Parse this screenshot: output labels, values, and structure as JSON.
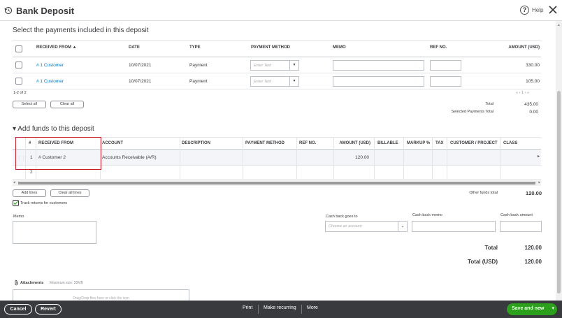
{
  "header": {
    "title": "Bank Deposit",
    "help": "Help",
    "help_icon": "?"
  },
  "payments": {
    "heading": "Select the payments included in this deposit",
    "columns": [
      "RECEIVED FROM ▲",
      "DATE",
      "TYPE",
      "PAYMENT METHOD",
      "MEMO",
      "REF NO.",
      "AMOUNT (USD)"
    ],
    "rows": [
      {
        "received_from": "# 1 Customer",
        "date": "10/07/2021",
        "type": "Payment",
        "method_placeholder": "Enter Text",
        "amount": "330.00"
      },
      {
        "received_from": "# 1 Customer",
        "date": "10/07/2021",
        "type": "Payment",
        "method_placeholder": "Enter Text",
        "amount": "105.00"
      }
    ],
    "range": "1-2 of 2",
    "pager": "« ‹ 1 › »",
    "select_all": "Select all",
    "clear_all": "Clear all",
    "total_label": "Total",
    "total_value": "435.00",
    "selected_label": "Selected Payments Total",
    "selected_value": "0.00"
  },
  "funds": {
    "heading": "▾  Add funds to this deposit",
    "columns": [
      "#",
      "RECEIVED FROM",
      "ACCOUNT",
      "DESCRIPTION",
      "PAYMENT METHOD",
      "REF NO.",
      "AMOUNT (USD)",
      "BILLABLE",
      "MARKUP %",
      "TAX",
      "CUSTOMER / PROJECT",
      "CLASS"
    ],
    "rows": [
      {
        "num": "1",
        "received_from": "# Customer 2",
        "account": "Accounts Receivable (A/R)",
        "amount": "120.00"
      },
      {
        "num": "2",
        "received_from": "",
        "account": "",
        "amount": ""
      }
    ],
    "add_lines": "Add lines",
    "clear_all_lines": "Clear all lines",
    "other_funds_label": "Other funds total",
    "other_funds_value": "120.00",
    "track_returns": "Track returns for customers"
  },
  "memo": {
    "label": "Memo"
  },
  "cash_back": {
    "goes_to_label": "Cash back goes to",
    "goes_to_placeholder": "Choose an account",
    "memo_label": "Cash back memo",
    "amount_label": "Cash back amount"
  },
  "totals": {
    "total_label": "Total",
    "total_value": "120.00",
    "total_usd_label": "Total (USD)",
    "total_usd_value": "120.00"
  },
  "attachments": {
    "label": "Attachments",
    "max_size": "Maximum size: 20MB",
    "drop_hint": "Drag/Drop files here or click the icon"
  },
  "footer": {
    "cancel": "Cancel",
    "revert": "Revert",
    "print": "Print",
    "make_recurring": "Make recurring",
    "more": "More",
    "save_new": "Save and new"
  },
  "colors": {
    "link": "#0077c5",
    "primary": "#2ca01c",
    "footer_bg": "#393a3d",
    "highlight": "#c8202f"
  }
}
